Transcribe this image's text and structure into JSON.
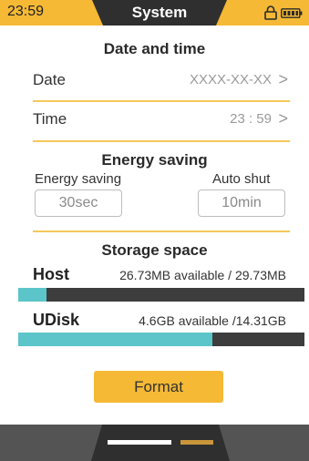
{
  "status": {
    "time": "23:59",
    "title": "System"
  },
  "colors": {
    "accent": "#f5b935",
    "bar_fill": "#5bc5c9",
    "bar_track": "#3d3d3d",
    "dark": "#2f2f2f"
  },
  "icons": {
    "lock": "lock-icon",
    "battery": "battery-icon",
    "chevron": "chevron-right-icon"
  },
  "date_time": {
    "title": "Date and time",
    "date": {
      "label": "Date",
      "value": "XXXX-XX-XX",
      "chevron": ">"
    },
    "time": {
      "label": "Time",
      "value": "23 : 59",
      "chevron": ">"
    }
  },
  "energy": {
    "title": "Energy saving",
    "saving": {
      "label": "Energy saving",
      "value": "30sec"
    },
    "shutdown": {
      "label": "Auto shut",
      "value": "10min"
    }
  },
  "storage": {
    "title": "Storage space",
    "host": {
      "name": "Host",
      "info": "26.73MB available / 29.73MB",
      "used_fraction": 0.1
    },
    "udisk": {
      "name": "UDisk",
      "info": "4.6GB available /14.31GB",
      "used_fraction": 0.6786
    }
  },
  "format_label": "Format",
  "pagination": {
    "total": 2,
    "active": 1
  }
}
